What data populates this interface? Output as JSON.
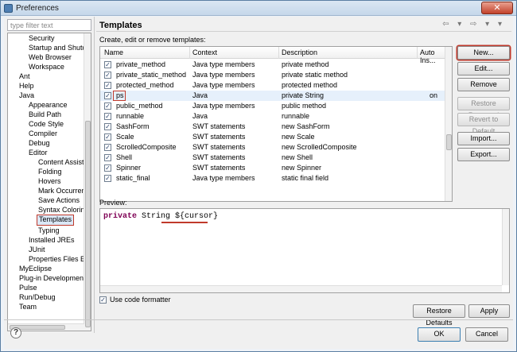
{
  "window": {
    "title": "Preferences",
    "close_label": "✕"
  },
  "filter": {
    "placeholder": "type filter text"
  },
  "tree": {
    "items": [
      {
        "label": "Security"
      },
      {
        "label": "Startup and Shutd"
      },
      {
        "label": "Web Browser"
      },
      {
        "label": "Workspace"
      },
      {
        "label": "Ant"
      },
      {
        "label": "Help"
      },
      {
        "label": "Java"
      },
      {
        "label": "Appearance"
      },
      {
        "label": "Build Path"
      },
      {
        "label": "Code Style"
      },
      {
        "label": "Compiler"
      },
      {
        "label": "Debug"
      },
      {
        "label": "Editor"
      },
      {
        "label": "Content Assist"
      },
      {
        "label": "Folding"
      },
      {
        "label": "Hovers"
      },
      {
        "label": "Mark Occurren"
      },
      {
        "label": "Save Actions"
      },
      {
        "label": "Syntax Coloring"
      },
      {
        "label": "Templates"
      },
      {
        "label": "Typing"
      },
      {
        "label": "Installed JREs"
      },
      {
        "label": "JUnit"
      },
      {
        "label": "Properties Files Ed"
      },
      {
        "label": "MyEclipse"
      },
      {
        "label": "Plug-in Development"
      },
      {
        "label": "Pulse"
      },
      {
        "label": "Run/Debug"
      },
      {
        "label": "Team"
      }
    ]
  },
  "page": {
    "title": "Templates",
    "subtitle": "Create, edit or remove templates:",
    "nav": "⇦ ▾ ⇨ ▾ ▾"
  },
  "table": {
    "headers": [
      "Name",
      "Context",
      "Description",
      "Auto Ins..."
    ],
    "rows": [
      {
        "name": "private_method",
        "context": "Java type members",
        "description": "private method",
        "auto": ""
      },
      {
        "name": "private_static_method",
        "context": "Java type members",
        "description": "private static method",
        "auto": ""
      },
      {
        "name": "protected_method",
        "context": "Java type members",
        "description": "protected method",
        "auto": ""
      },
      {
        "name": "ps",
        "context": "Java",
        "description": "private String",
        "auto": "on"
      },
      {
        "name": "public_method",
        "context": "Java type members",
        "description": "public method",
        "auto": ""
      },
      {
        "name": "runnable",
        "context": "Java",
        "description": "runnable",
        "auto": ""
      },
      {
        "name": "SashForm",
        "context": "SWT statements",
        "description": "new SashForm",
        "auto": ""
      },
      {
        "name": "Scale",
        "context": "SWT statements",
        "description": "new Scale",
        "auto": ""
      },
      {
        "name": "ScrolledComposite",
        "context": "SWT statements",
        "description": "new ScrolledComposite",
        "auto": ""
      },
      {
        "name": "Shell",
        "context": "SWT statements",
        "description": "new Shell",
        "auto": ""
      },
      {
        "name": "Spinner",
        "context": "SWT statements",
        "description": "new Spinner",
        "auto": ""
      },
      {
        "name": "static_final",
        "context": "Java type members",
        "description": "static final field",
        "auto": ""
      }
    ],
    "check_glyph": "✓"
  },
  "buttons": {
    "new": "New...",
    "edit": "Edit...",
    "remove": "Remove",
    "restore_removed": "Restore Removed",
    "revert": "Revert to Default",
    "import": "Import...",
    "export": "Export...",
    "restore_defaults": "Restore Defaults",
    "apply": "Apply",
    "ok": "OK",
    "cancel": "Cancel"
  },
  "preview": {
    "label": "Preview:",
    "keyword": "private",
    "rest": " String ",
    "variable": "${cursor}"
  },
  "formatter": {
    "label": "Use code formatter",
    "check_glyph": "✓"
  },
  "help": {
    "glyph": "?"
  },
  "colors": {
    "highlight_red": "#c0392b",
    "keyword": "#7f0055"
  }
}
